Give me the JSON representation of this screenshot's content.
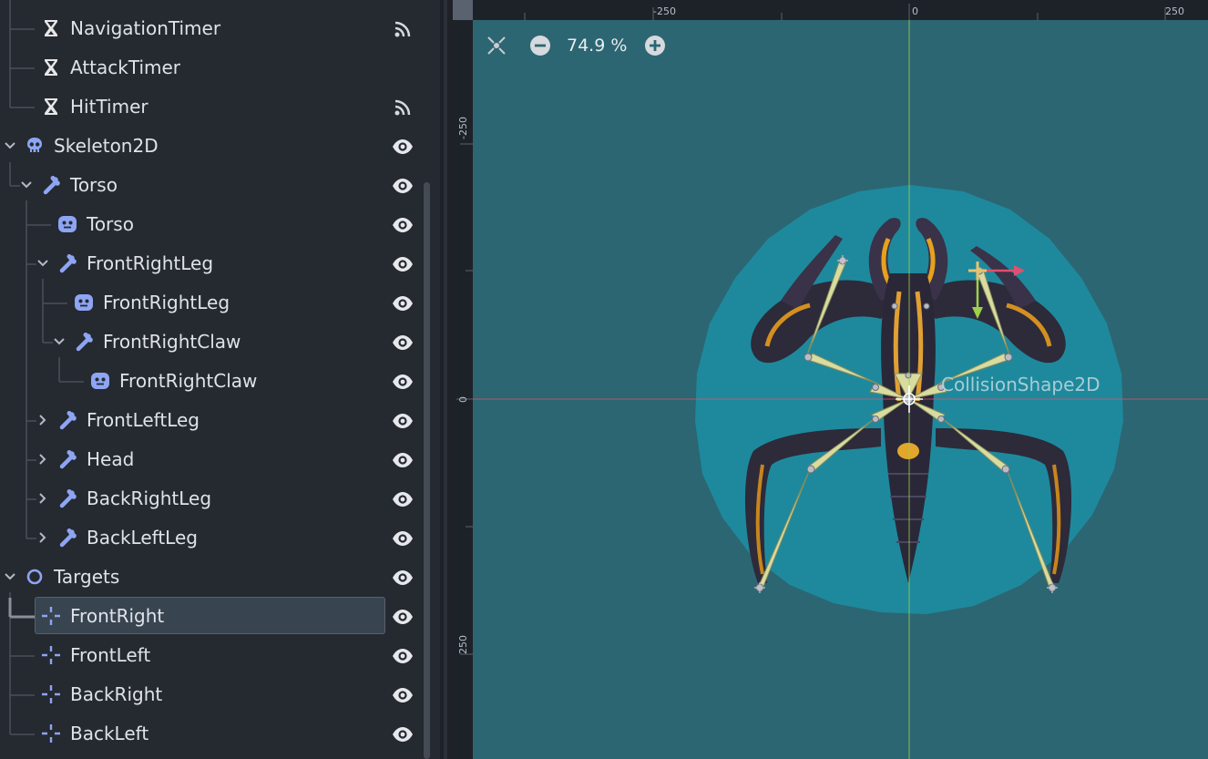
{
  "tree": {
    "rows": [
      {
        "label": "NavigationTimer",
        "icon": "hourglass-icon",
        "trailing": "signal-icon"
      },
      {
        "label": "AttackTimer",
        "icon": "hourglass-icon",
        "trailing": ""
      },
      {
        "label": "HitTimer",
        "icon": "hourglass-icon",
        "trailing": "signal-icon"
      },
      {
        "label": "Skeleton2D",
        "icon": "skull-icon",
        "trailing": "eye-icon"
      },
      {
        "label": "Torso",
        "icon": "bone-icon",
        "trailing": "eye-icon"
      },
      {
        "label": "Torso",
        "icon": "sprite-face-icon",
        "trailing": "eye-icon"
      },
      {
        "label": "FrontRightLeg",
        "icon": "bone-icon",
        "trailing": "eye-icon"
      },
      {
        "label": "FrontRightLeg",
        "icon": "sprite-face-icon",
        "trailing": "eye-icon"
      },
      {
        "label": "FrontRightClaw",
        "icon": "bone-icon",
        "trailing": "eye-icon"
      },
      {
        "label": "FrontRightClaw",
        "icon": "sprite-face-icon",
        "trailing": "eye-icon"
      },
      {
        "label": "FrontLeftLeg",
        "icon": "bone-icon",
        "trailing": "eye-icon"
      },
      {
        "label": "Head",
        "icon": "bone-icon",
        "trailing": "eye-icon"
      },
      {
        "label": "BackRightLeg",
        "icon": "bone-icon",
        "trailing": "eye-icon"
      },
      {
        "label": "BackLeftLeg",
        "icon": "bone-icon",
        "trailing": "eye-icon"
      },
      {
        "label": "Targets",
        "icon": "node2d-circle-icon",
        "trailing": "eye-icon"
      },
      {
        "label": "FrontRight",
        "icon": "marker-icon",
        "trailing": "eye-icon",
        "selected": true
      },
      {
        "label": "FrontLeft",
        "icon": "marker-icon",
        "trailing": "eye-icon"
      },
      {
        "label": "BackRight",
        "icon": "marker-icon",
        "trailing": "eye-icon"
      },
      {
        "label": "BackLeft",
        "icon": "marker-icon",
        "trailing": "eye-icon"
      }
    ]
  },
  "viewport": {
    "zoom_level": "74.9 %",
    "ruler_top": {
      "minus": "-250",
      "zero": "0",
      "plus": "250"
    },
    "ruler_left": {
      "minus": "-250",
      "zero": "0",
      "plus": "250"
    },
    "collision_label": "CollisionShape2D",
    "colors": {
      "background": "#2c6672",
      "collision_fill": "#1c8fa5",
      "bone": "#d8dca0",
      "x_axis": "#e05070",
      "y_axis": "#9ed04a"
    }
  }
}
